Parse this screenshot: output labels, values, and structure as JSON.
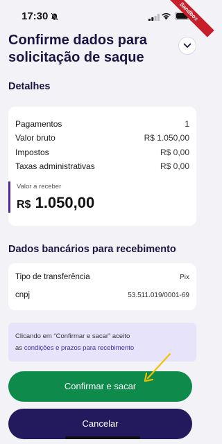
{
  "status_bar": {
    "time": "17:30",
    "sandbox_label": "Sandbox",
    "icons": [
      "bell-off-icon",
      "signal-icon",
      "wifi-icon",
      "battery-icon"
    ]
  },
  "header": {
    "title": "Confirme dados para solicitação de saque",
    "collapse_icon": "chevron-down-icon"
  },
  "details": {
    "section_title": "Detalhes",
    "rows": [
      {
        "label": "Pagamentos",
        "value": "1"
      },
      {
        "label": "Valor bruto",
        "value": "R$ 1.050,00"
      },
      {
        "label": "Impostos",
        "value": "R$ 0,00"
      },
      {
        "label": "Taxas administrativas",
        "value": "R$ 0,00"
      }
    ],
    "receive_label": "Valor a receber",
    "receive_currency": "R$",
    "receive_amount": "1.050,00"
  },
  "bank": {
    "section_title": "Dados bancários para recebimento",
    "rows": [
      {
        "label": "Tipo de transferência",
        "value": "Pix"
      },
      {
        "label": "cnpj",
        "value": "53.511.019/0001-69"
      }
    ]
  },
  "notice": {
    "text": "Clicando em “Confirmar e sacar” aceito",
    "prefix": "as",
    "link": "condições e prazos para recebimento"
  },
  "actions": {
    "confirm_label": "Confirmar e sacar",
    "cancel_label": "Cancelar"
  },
  "colors": {
    "accent_purple": "#221a5c",
    "confirm_green": "#0e8a4b",
    "annotation_yellow": "#f2c200"
  }
}
